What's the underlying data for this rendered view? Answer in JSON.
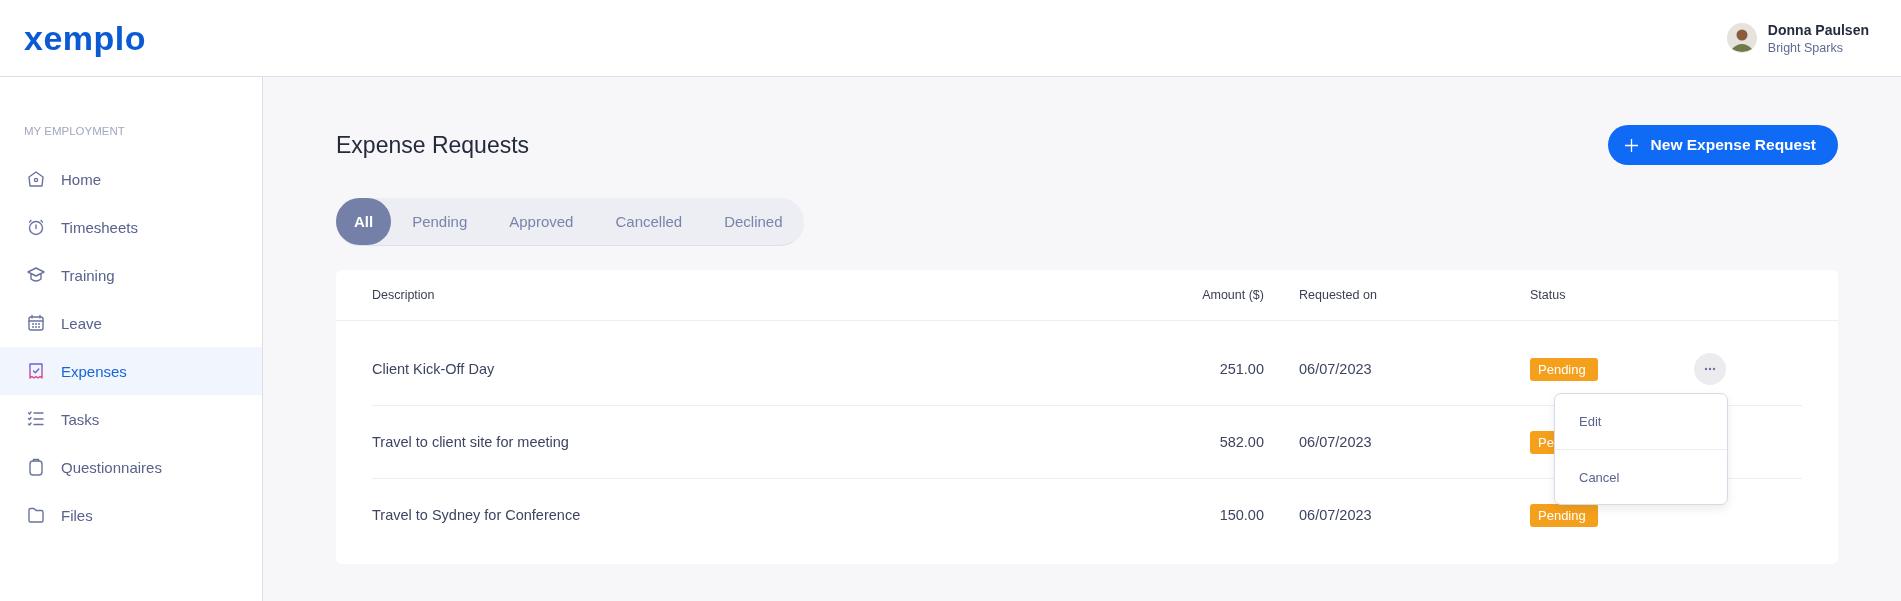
{
  "header": {
    "logo": "xemplo",
    "user": {
      "name": "Donna Paulsen",
      "company": "Bright Sparks"
    }
  },
  "sidebar": {
    "section": "MY EMPLOYMENT",
    "items": [
      {
        "label": "Home",
        "selected": false
      },
      {
        "label": "Timesheets",
        "selected": false
      },
      {
        "label": "Training",
        "selected": false
      },
      {
        "label": "Leave",
        "selected": false
      },
      {
        "label": "Expenses",
        "selected": true
      },
      {
        "label": "Tasks",
        "selected": false
      },
      {
        "label": "Questionnaires",
        "selected": false
      },
      {
        "label": "Files",
        "selected": false
      }
    ]
  },
  "page": {
    "title": "Expense Requests",
    "new_button": "New Expense Request"
  },
  "tabs": [
    {
      "label": "All",
      "selected": true
    },
    {
      "label": "Pending",
      "selected": false
    },
    {
      "label": "Approved",
      "selected": false
    },
    {
      "label": "Cancelled",
      "selected": false
    },
    {
      "label": "Declined",
      "selected": false
    }
  ],
  "table": {
    "columns": [
      "Description",
      "Amount ($)",
      "Requested on",
      "Status"
    ],
    "rows": [
      {
        "description": "Client Kick-Off Day",
        "amount": "251.00",
        "requested_on": "06/07/2023",
        "status": "Pending",
        "actions_button": true,
        "menu": {
          "items": [
            "Edit",
            "Cancel"
          ]
        }
      },
      {
        "description": "Travel to client site for meeting",
        "amount": "582.00",
        "requested_on": "06/07/2023",
        "status": "Pe",
        "actions_button": false
      },
      {
        "description": "Travel to Sydney for Conference",
        "amount": "150.00",
        "requested_on": "06/07/2023",
        "status": "Pending",
        "actions_button": false
      }
    ]
  }
}
